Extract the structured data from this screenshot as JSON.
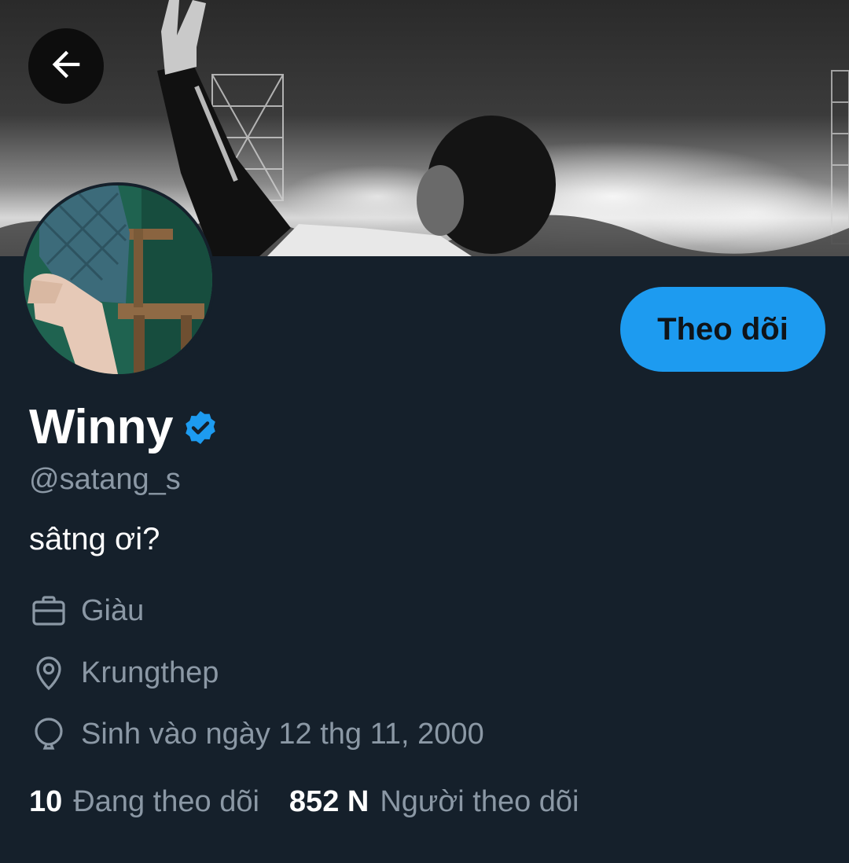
{
  "header": {
    "back_icon": "arrow-left-icon",
    "banner_description_icon": "concert-banner-image"
  },
  "profile": {
    "display_name": "Winny",
    "verified_icon": "verified-badge-icon",
    "handle": "@satang_s",
    "bio": "sâtng ơi?",
    "follow_button_label": "Theo dõi"
  },
  "meta": {
    "profession_icon": "briefcase-icon",
    "profession": "Giàu",
    "location_icon": "location-pin-icon",
    "location": "Krungthep",
    "birthday_icon": "balloon-icon",
    "birthday": "Sinh vào ngày 12 thg 11, 2000"
  },
  "stats": {
    "following_count": "10",
    "following_label": "Đang theo dõi",
    "followers_count": "852 N",
    "followers_label": "Người theo dõi"
  },
  "colors": {
    "background": "#15202b",
    "accent": "#1d9bf0",
    "secondary_text": "#8b98a5",
    "primary_text": "#ffffff"
  }
}
